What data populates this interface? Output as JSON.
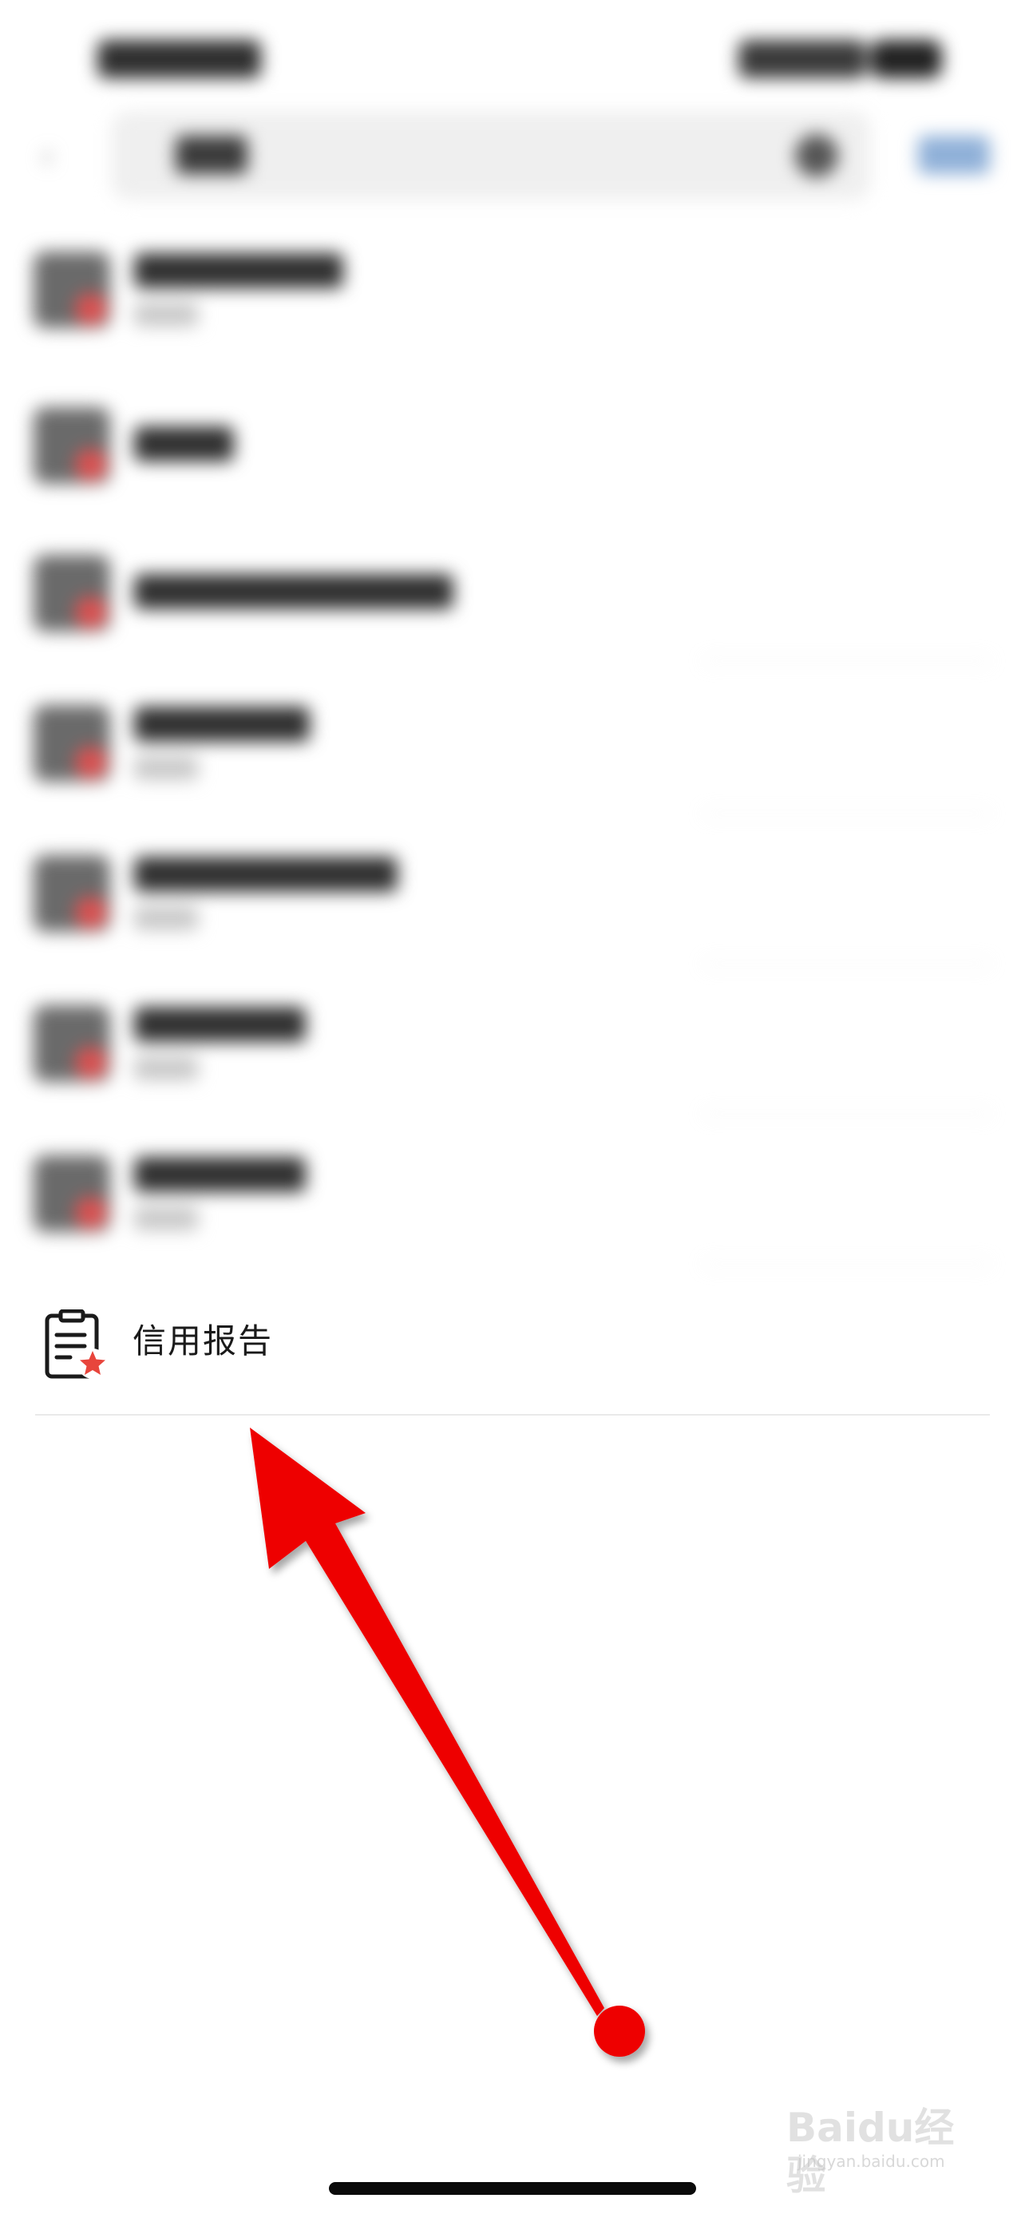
{
  "credit_item": {
    "label": "信用报告",
    "icon": "report-star-icon"
  },
  "colors": {
    "annotation_arrow": "#ee0000",
    "icon_star": "#e8453c"
  },
  "watermark": {
    "text": "Baidu经验",
    "subtext": "jingyan.baidu.com"
  }
}
